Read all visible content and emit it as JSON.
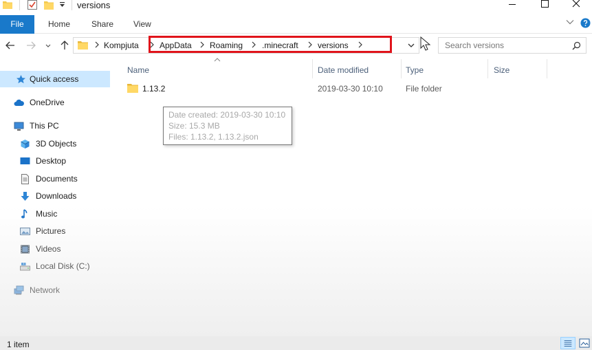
{
  "window": {
    "title": "versions"
  },
  "ribbon": {
    "tabs": [
      "File",
      "Home",
      "Share",
      "View"
    ]
  },
  "address": {
    "crumbs": [
      "Kompjuta",
      "AppData",
      "Roaming",
      ".minecraft",
      "versions"
    ]
  },
  "search": {
    "placeholder": "Search versions",
    "value": ""
  },
  "colors": {
    "accent": "#1979ca",
    "selected": "#cce8ff",
    "highlight": "#e0131b"
  },
  "nav": {
    "items": [
      {
        "label": "Quick access",
        "icon": "star-icon"
      },
      {
        "label": "OneDrive",
        "icon": "cloud-icon"
      },
      {
        "label": "This PC",
        "icon": "computer-icon"
      },
      {
        "label": "3D Objects",
        "icon": "cube-icon"
      },
      {
        "label": "Desktop",
        "icon": "desktop-icon"
      },
      {
        "label": "Documents",
        "icon": "document-icon"
      },
      {
        "label": "Downloads",
        "icon": "download-icon"
      },
      {
        "label": "Music",
        "icon": "music-icon"
      },
      {
        "label": "Pictures",
        "icon": "picture-icon"
      },
      {
        "label": "Videos",
        "icon": "video-icon"
      },
      {
        "label": "Local Disk (C:)",
        "icon": "drive-icon"
      },
      {
        "label": "Network",
        "icon": "network-icon"
      }
    ]
  },
  "columns": [
    "Name",
    "Date modified",
    "Type",
    "Size"
  ],
  "files": [
    {
      "name": "1.13.2",
      "date": "2019-03-30 10:10",
      "type": "File folder",
      "size": ""
    }
  ],
  "tooltip": {
    "created": "Date created: 2019-03-30 10:10",
    "size": "Size: 15.3 MB",
    "files": "Files: 1.13.2, 1.13.2.json"
  },
  "status": {
    "count": "1 item"
  }
}
